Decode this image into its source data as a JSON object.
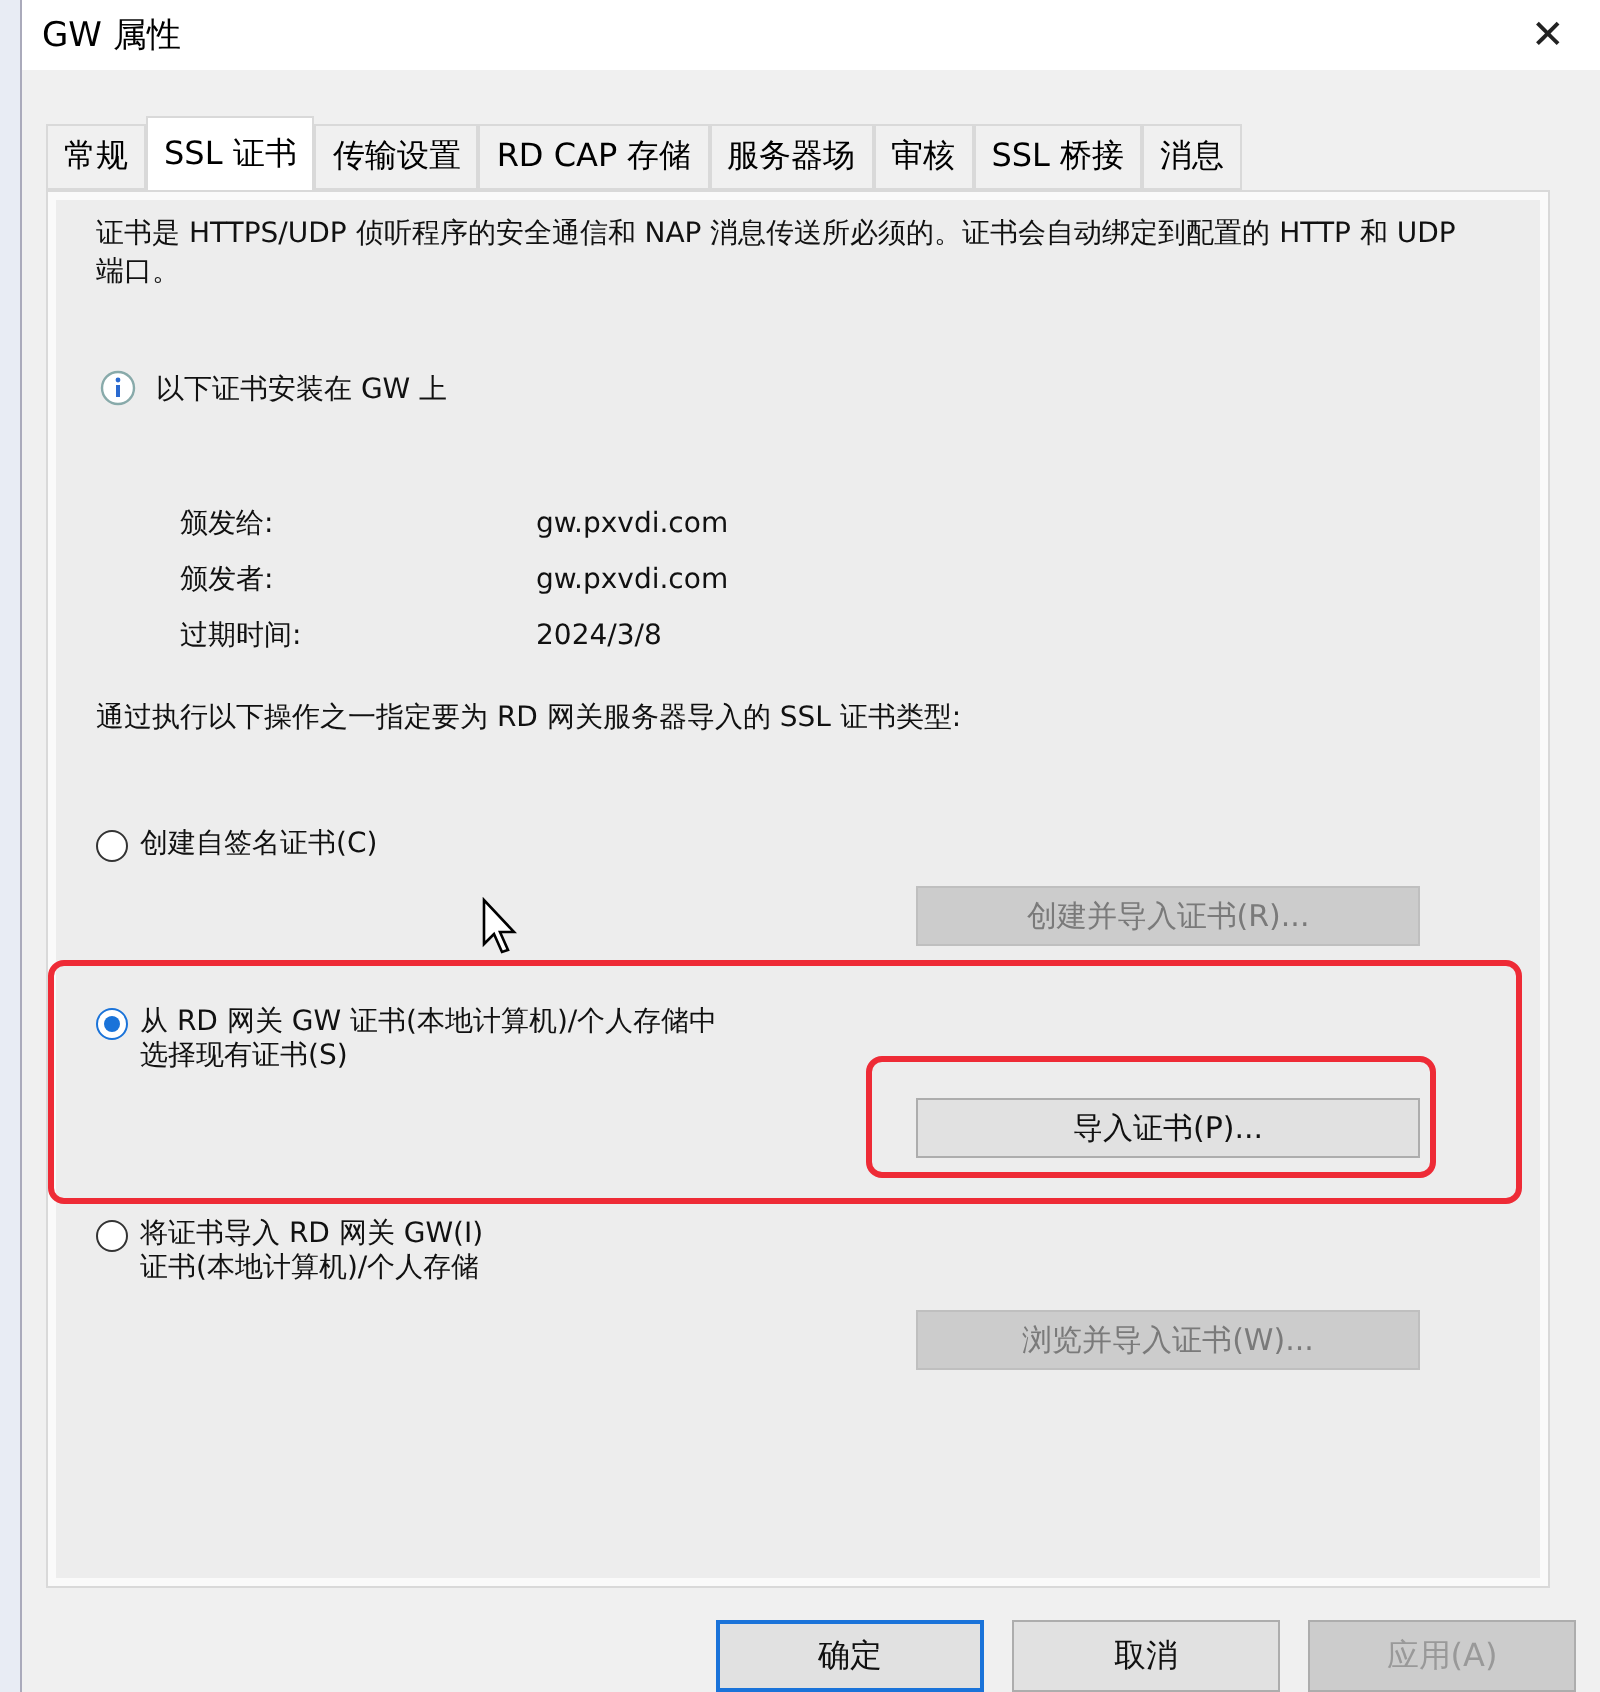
{
  "window": {
    "title": "GW 属性",
    "close": "✕"
  },
  "tabs": [
    {
      "label": "常规",
      "selected": false
    },
    {
      "label": "SSL 证书",
      "selected": true
    },
    {
      "label": "传输设置",
      "selected": false
    },
    {
      "label": "RD CAP 存储",
      "selected": false
    },
    {
      "label": "服务器场",
      "selected": false
    },
    {
      "label": "审核",
      "selected": false
    },
    {
      "label": "SSL 桥接",
      "selected": false
    },
    {
      "label": "消息",
      "selected": false
    }
  ],
  "description": "证书是 HTTPS/UDP 侦听程序的安全通信和 NAP 消息传送所必须的。证书会自动绑定到配置的 HTTP 和 UDP 端口。",
  "info": "以下证书安装在 GW 上",
  "details": [
    {
      "label": "颁发给:",
      "value": "gw.pxvdi.com"
    },
    {
      "label": "颁发者:",
      "value": "gw.pxvdi.com"
    },
    {
      "label": "过期时间:",
      "value": "2024/3/8"
    }
  ],
  "prompt": "通过执行以下操作之一指定要为 RD 网关服务器导入的 SSL 证书类型:",
  "options": [
    {
      "lines": [
        "创建自签名证书(C)"
      ],
      "selected": false,
      "button": {
        "label": "创建并导入证书(R)...",
        "disabled": true
      }
    },
    {
      "lines": [
        "从 RD 网关 GW 证书(本地计算机)/个人存储中",
        "选择现有证书(S)"
      ],
      "selected": true,
      "button": {
        "label": "导入证书(P)...",
        "disabled": false
      }
    },
    {
      "lines": [
        "将证书导入 RD 网关 GW(I)",
        "证书(本地计算机)/个人存储"
      ],
      "selected": false,
      "button": {
        "label": "浏览并导入证书(W)...",
        "disabled": true
      }
    }
  ],
  "footer_buttons": [
    {
      "label": "确定",
      "default": true,
      "disabled": false
    },
    {
      "label": "取消",
      "default": false,
      "disabled": false
    },
    {
      "label": "应用(A)",
      "default": false,
      "disabled": true
    }
  ]
}
